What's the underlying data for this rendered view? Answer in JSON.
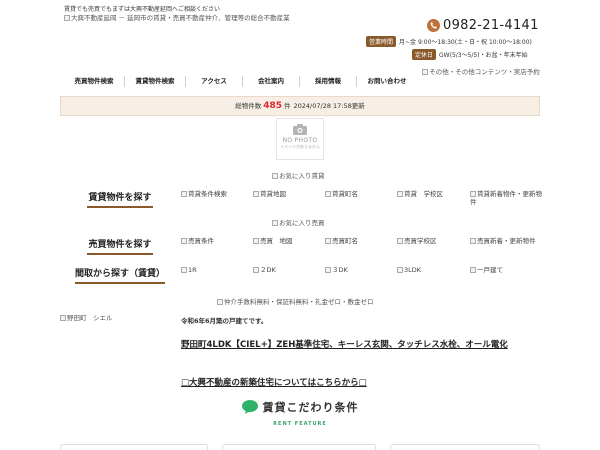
{
  "header": {
    "tagline": "賃貸でも売買でもまずは大興不動産延岡へご相談ください",
    "logo_alt": "大興不動産延岡 － 延岡市の賃貸・売買不動産仲介、管理等の総合不動産業",
    "phone": "0982-21-4141",
    "hours_label": "営業時間",
    "hours_text": "月~金 9:00～18:30(土・日・祝 10:00～18:00)",
    "holiday_label": "定休日",
    "holiday_text": "GW(5/3～5/5)・お盆・年末年始",
    "accent_color": "#8a5a2b",
    "phone_icon_color": "#c0703a"
  },
  "nav": {
    "items": [
      "売買物件検索",
      "賃貸物件検索",
      "アクセス",
      "会社案内",
      "採用情報",
      "お問い合わせ"
    ],
    "other_alt": "その他・その他コンテンツ・実店予約"
  },
  "stats": {
    "label": "総物件数",
    "count": "485",
    "unit": "件",
    "updated": "2024/07/28 17:58更新",
    "count_color": "#e0262f"
  },
  "nophoto": {
    "main": "NO PHOTO",
    "sub": "イメージがありません"
  },
  "rent": {
    "fav_alt": "お気に入り賃貸",
    "title": "賃貸物件を探す",
    "links": [
      "賃貸条件検索",
      "賃貸地図",
      "賃貸町名",
      "賃貸　学校区",
      "賃貸新着物件・更新物件"
    ]
  },
  "sale": {
    "fav_alt": "お気に入り売買",
    "title": "売買物件を探す",
    "links": [
      "売買条件",
      "売買　地図",
      "売買町名",
      "売買学校区",
      "売買新着・更新物件"
    ]
  },
  "layout_search": {
    "title": "間取から探す（賃貸）",
    "links": [
      "1R",
      "２DK",
      "３DK",
      "3LDK",
      "一戸建て"
    ]
  },
  "banner_alt": "仲介手数料無料・保証料無料・礼金ゼロ・敷金ゼロ",
  "feature": {
    "image_alt": "野田町　シエル",
    "date_text": "令和6年6月築の戸建てです。",
    "headline": "野田町4LDK【CIEL+】ZEH基準住宅、キーレス玄関、タッチレス水栓、オール電化",
    "link": "□大興不動産の新築住宅についてはこちらから□"
  },
  "rent_feature": {
    "title": "賃貸こだわり条件",
    "sub": "RENT FEATURE",
    "title_color": "#333333",
    "sub_color": "#3aa66a",
    "icon_color": "#2fb36b"
  }
}
